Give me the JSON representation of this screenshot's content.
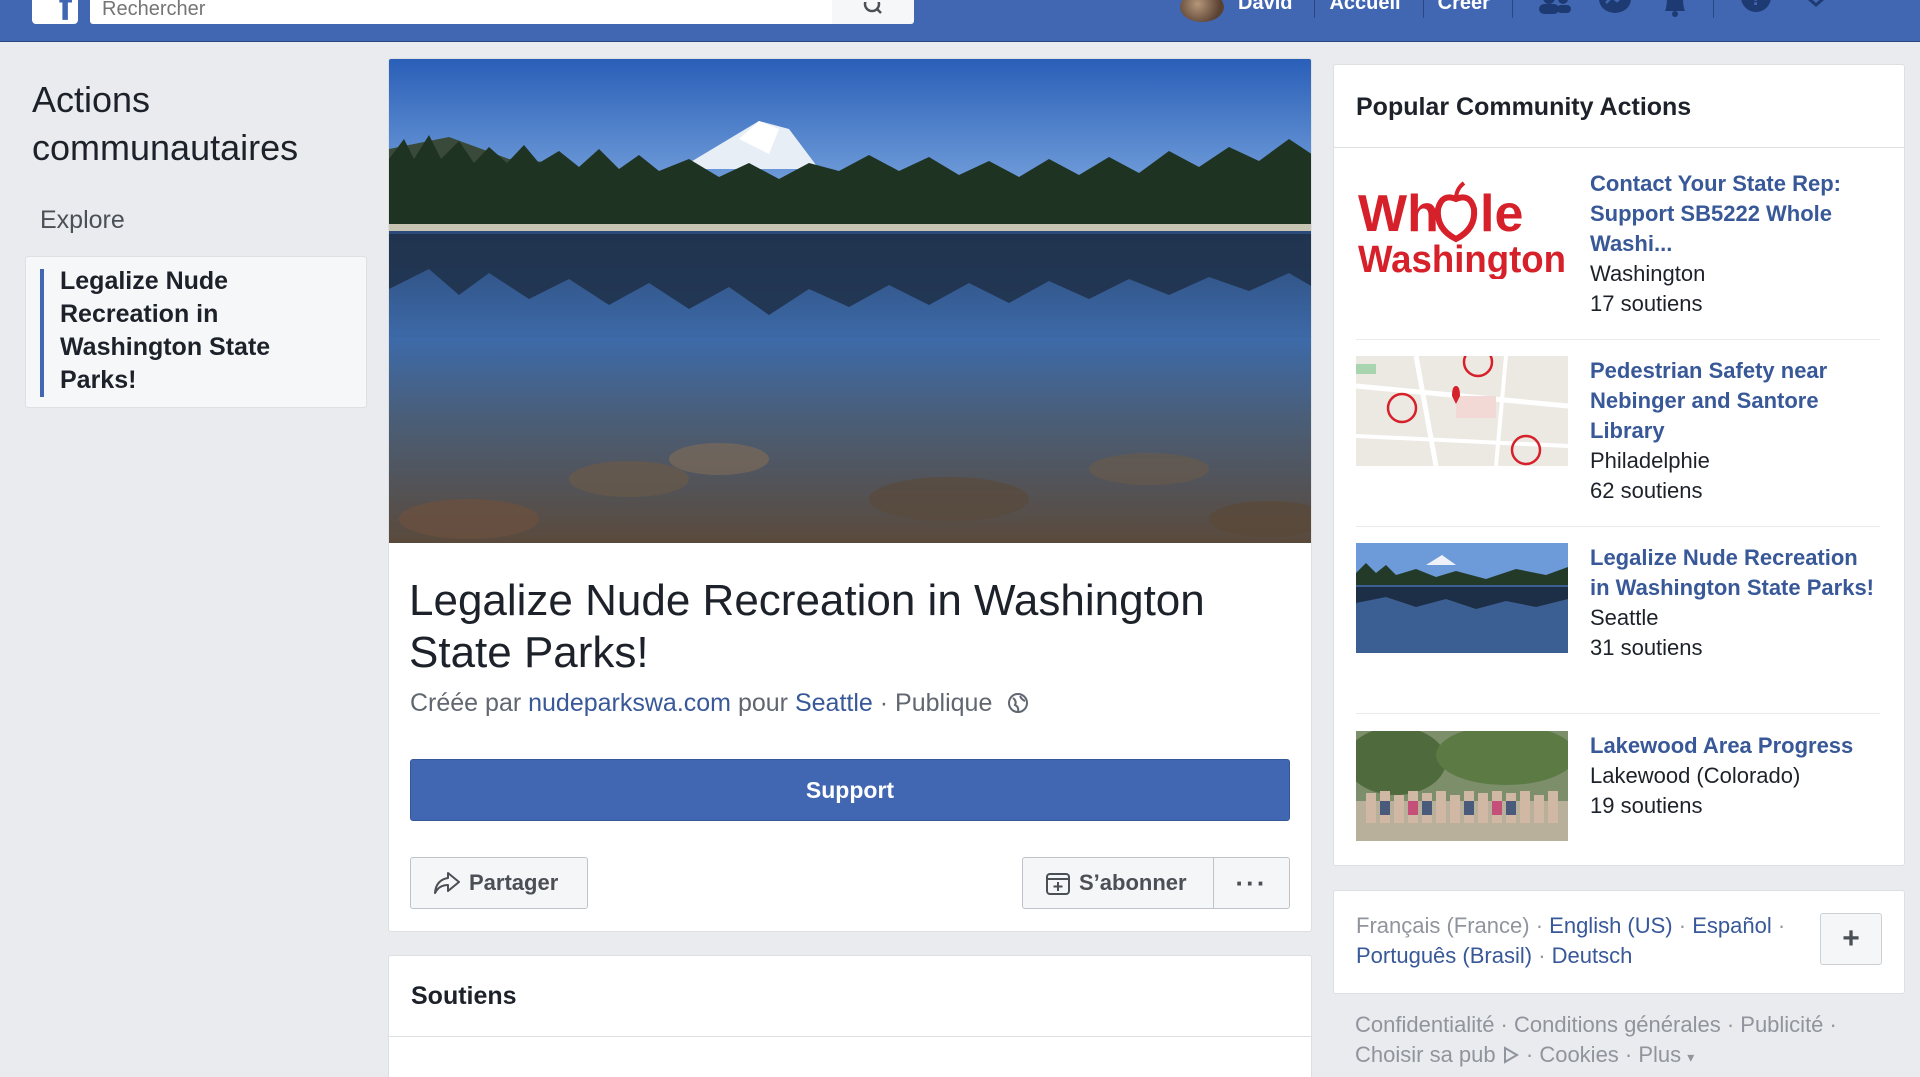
{
  "topbar": {
    "logo": "f",
    "search_placeholder": "Rechercher",
    "user_name": "David",
    "home": "Accueil",
    "create": "Créer"
  },
  "sidebar": {
    "title": "Actions communautaires",
    "explore": "Explore",
    "active_item": "Legalize Nude Recreation in Washington State Parks!"
  },
  "main": {
    "title": "Legalize Nude Recreation in Washington State Parks!",
    "created_by_prefix": "Créée par",
    "creator": "nudeparkswa.com",
    "for_word": "pour",
    "city": "Seattle",
    "privacy": "Publique",
    "support_label": "Support",
    "share_label": "Partager",
    "subscribe_label": "S’abonner",
    "more_label": "···"
  },
  "soutiens": {
    "heading": "Soutiens"
  },
  "popular": {
    "heading": "Popular Community Actions",
    "items": [
      {
        "name": "Contact Your State Rep: Support SB5222 Whole Washi...",
        "location": "Washington",
        "count": "17 soutiens",
        "thumb": "whole-washington-logo"
      },
      {
        "name": "Pedestrian Safety near Nebinger and Santore Library",
        "location": "Philadelphie",
        "count": "62 soutiens",
        "thumb": "map"
      },
      {
        "name": "Legalize Nude Recreation in Washington State Parks!",
        "location": "Seattle",
        "count": "31 soutiens",
        "thumb": "lake-photo"
      },
      {
        "name": "Lakewood Area Progress",
        "location": "Lakewood (Colorado)",
        "count": "19 soutiens",
        "thumb": "group-photo"
      }
    ],
    "logo_text_line1_a": "Wh",
    "logo_text_line1_b": "le",
    "logo_text_line2": "Washington"
  },
  "languages": {
    "current": "Français (France)",
    "others": [
      "English (US)",
      "Español",
      "Português (Brasil)",
      "Deutsch"
    ],
    "plus": "+"
  },
  "footer": {
    "links": [
      "Confidentialité",
      "Conditions générales",
      "Publicité",
      "Choisir sa pub",
      "Cookies",
      "Plus"
    ]
  },
  "colors": {
    "brand": "#4267b2",
    "link": "#385898",
    "logo_red": "#d6202a"
  }
}
